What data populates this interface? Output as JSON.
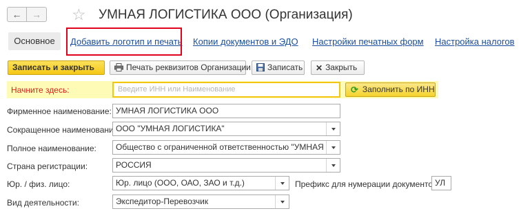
{
  "header": {
    "back_icon": "arrow-left-icon",
    "back_glyph": "←",
    "forward_icon": "arrow-right-icon",
    "forward_glyph": "→",
    "star_glyph": "☆",
    "title": "УМНАЯ ЛОГИСТИКА ООО (Организация)"
  },
  "tabs": {
    "main": "Основное",
    "links": [
      "Добавить логотип и печать",
      "Копии документов и ЭДО",
      "Настройки печатных форм",
      "Настройка налогов"
    ],
    "highlight_color": "#e0001b"
  },
  "toolbar": {
    "save_close": "Записать и закрыть",
    "print_details": "Печать реквизитов Организации",
    "save": "Записать",
    "close": "Закрыть"
  },
  "start": {
    "label": "Начните здесь:",
    "placeholder": "Введите ИНН или Наименование",
    "fill_button": "Заполнить по ИНН"
  },
  "form": {
    "firm_name_label": "Фирменное наименование:",
    "firm_name_value": "УМНАЯ ЛОГИСТИКА ООО",
    "short_name_label": "Сокращенное наименование:",
    "short_name_value": "ООО \"УМНАЯ ЛОГИСТИКА\"",
    "full_name_label": "Полное наименование:",
    "full_name_value": "Общество с ограниченной ответственностью \"УМНАЯ ЛОГИ",
    "country_label": "Страна регистрации:",
    "country_value": "РОССИЯ",
    "entity_label": "Юр. / физ. лицо:",
    "entity_value": "Юр. лицо (ООО, ОАО, ЗАО и т.д.)",
    "prefix_label": "Префикс для нумерации документов :",
    "prefix_value": "УЛ",
    "activity_label": "Вид деятельности:",
    "activity_value": "Экспедитор-Перевозчик"
  },
  "colors": {
    "primary_button": "#f4c816",
    "start_row_bg": "#fdfbb5",
    "start_label": "#e11b1b",
    "link": "#1a4d9e"
  }
}
